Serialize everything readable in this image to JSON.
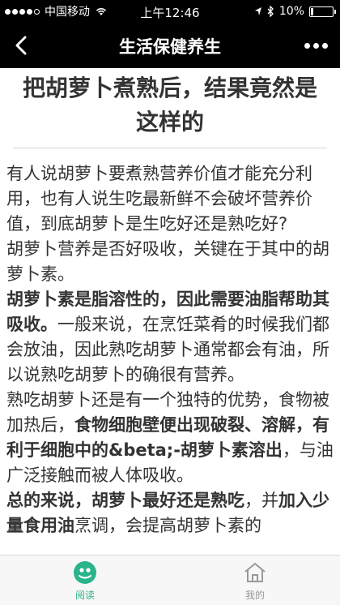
{
  "status_bar": {
    "carrier": "中国移动",
    "time": "上午12:46",
    "battery_percent": "10%",
    "battery_level": 0.1
  },
  "nav": {
    "title": "生活保健养生"
  },
  "article": {
    "title": "把胡萝卜煮熟后，结果竟然是这样的",
    "paragraphs": [
      [
        {
          "text": "有人说胡萝卜要煮熟营养价值才能充分利用，也有人说生吃最新鲜不会破坏营养价值，到底胡萝卜是生吃好还是熟吃好?",
          "bold": false
        }
      ],
      [
        {
          "text": "胡萝卜营养是否好吸收，关键在于其中的胡萝卜素。",
          "bold": false
        }
      ],
      [
        {
          "text": "胡萝卜素是脂溶性的，因此需要油脂帮助其吸收。",
          "bold": true
        },
        {
          "text": "一般来说，在烹饪菜肴的时候我们都会放油，因此熟吃胡萝卜通常都会有油，所以说熟吃胡萝卜的确很有营养。",
          "bold": false
        }
      ],
      [
        {
          "text": "熟吃胡萝卜还是有一个独特的优势，食物被加热后，",
          "bold": false
        },
        {
          "text": "食物细胞壁便出现破裂、溶解，有利于细胞中的&beta;-胡萝卜素溶出",
          "bold": true
        },
        {
          "text": "，与油广泛接触而被人体吸收。",
          "bold": false
        }
      ],
      [
        {
          "text": "总的来说，胡萝卜最好还是熟吃",
          "bold": true
        },
        {
          "text": "，并",
          "bold": false
        },
        {
          "text": "加入少量食用油",
          "bold": true
        },
        {
          "text": "烹调，会提高胡萝卜素的",
          "bold": false
        }
      ]
    ]
  },
  "tabs": [
    {
      "label": "阅读",
      "icon": "read-icon",
      "active": true
    },
    {
      "label": "我的",
      "icon": "home-icon",
      "active": false
    }
  ],
  "colors": {
    "accent": "#2bb38a",
    "nav_bg": "#000000",
    "tab_bg": "#f7f7f7"
  }
}
